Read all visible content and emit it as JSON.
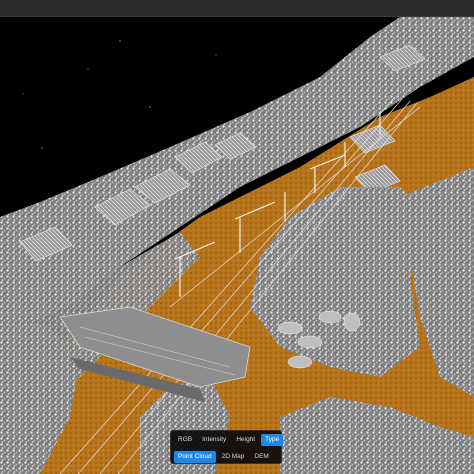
{
  "viewer": {
    "mode_tabs": [
      {
        "label": "RGB",
        "active": false
      },
      {
        "label": "Intensity",
        "active": false
      },
      {
        "label": "Height",
        "active": false
      },
      {
        "label": "Type",
        "active": true
      }
    ],
    "view_tabs": [
      {
        "label": "Point Cloud",
        "active": true
      },
      {
        "label": "2D Map",
        "active": false
      },
      {
        "label": "DEM",
        "active": false
      }
    ],
    "colors": {
      "background": "#000000",
      "ground": "#b8741a",
      "vegetation": "#c9c9c9",
      "accent": "#1e88e5"
    }
  }
}
